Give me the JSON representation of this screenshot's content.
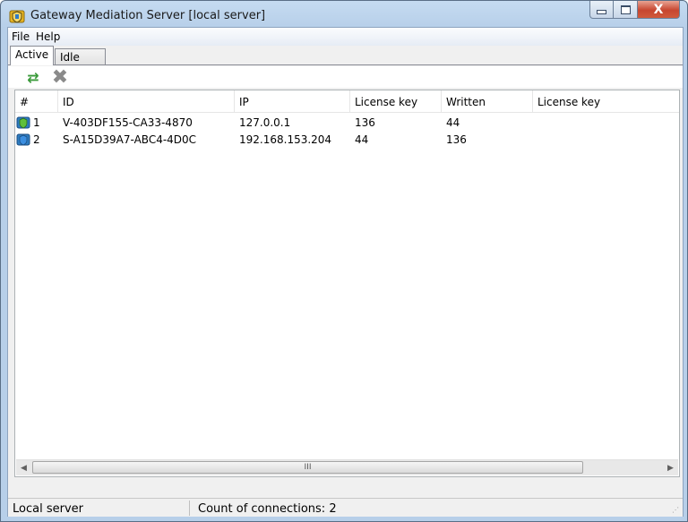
{
  "window": {
    "title": "Gateway Mediation Server [local server]",
    "icon": "shield-app-icon",
    "controls": [
      "minimize-icon",
      "maximize-icon",
      "close-icon"
    ],
    "close_glyph": "X"
  },
  "menu": {
    "file": "File",
    "help": "Help"
  },
  "tabs": [
    {
      "label": "Active",
      "selected": true
    },
    {
      "label": "Idle",
      "selected": false
    }
  ],
  "toolbar": {
    "refresh_icon": "refresh-icon",
    "delete_icon": "delete-icon",
    "refresh_glyph": "⇄",
    "delete_glyph": "✖"
  },
  "table": {
    "columns": [
      "#",
      "ID",
      "IP",
      "License key",
      "Written",
      "License key"
    ],
    "rows": [
      {
        "num": "1",
        "id": "V-403DF155-CA33-4870",
        "ip": "127.0.0.1",
        "license_key": "136",
        "written": "44",
        "license_key2": "",
        "icon": "connection-icon"
      },
      {
        "num": "2",
        "id": "S-A15D39A7-ABC4-4D0C",
        "ip": "192.168.153.204",
        "license_key": "44",
        "written": "136",
        "license_key2": "",
        "icon": "connection-icon"
      }
    ]
  },
  "scrollbar": {
    "thumb_grip": "III"
  },
  "status": {
    "server": "Local server",
    "connections": "Count of connections: 2"
  },
  "colors": {
    "title_bg": "#b7cfe9",
    "close_red": "#c7462f",
    "refresh_green": "#3a9a3a"
  }
}
